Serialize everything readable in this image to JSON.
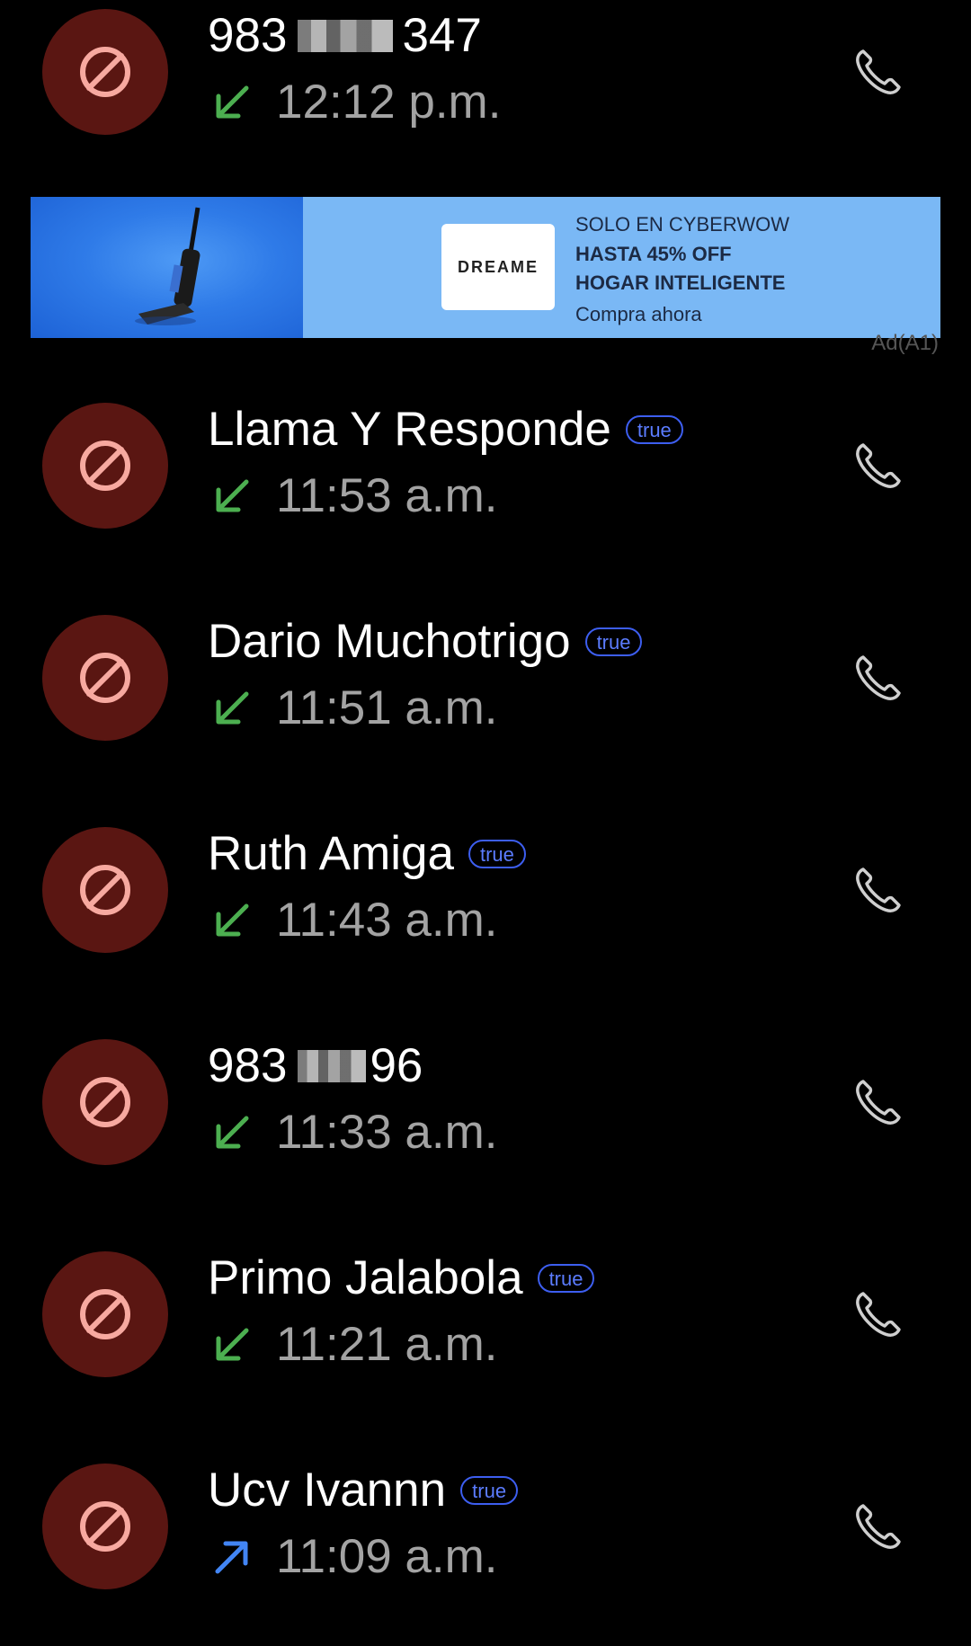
{
  "calls": [
    {
      "name_prefix": "983",
      "name_suffix": "347",
      "redacted": true,
      "time": "12:12 p.m.",
      "direction": "incoming",
      "badge": ""
    },
    {
      "name": "Llama Y Responde",
      "time": "11:53 a.m.",
      "direction": "incoming",
      "badge": "true"
    },
    {
      "name": "Dario Muchotrigo",
      "time": "11:51 a.m.",
      "direction": "incoming",
      "badge": "true"
    },
    {
      "name": "Ruth Amiga",
      "time": "11:43 a.m.",
      "direction": "incoming",
      "badge": "true"
    },
    {
      "name_prefix": "983",
      "name_suffix": "96",
      "redacted": true,
      "time": "11:33 a.m.",
      "direction": "incoming",
      "badge": ""
    },
    {
      "name": "Primo Jalabola",
      "time": "11:21 a.m.",
      "direction": "incoming",
      "badge": "true"
    },
    {
      "name": "Ucv Ivannn",
      "time": "11:09 a.m.",
      "direction": "outgoing",
      "badge": "true"
    }
  ],
  "ad": {
    "brand": "DREAME",
    "line1": "SOLO EN CYBERWOW",
    "line2": "HASTA 45% OFF",
    "line3": "HOGAR INTELIGENTE",
    "cta": "Compra ahora",
    "label": "Ad(A1)"
  },
  "icons": {
    "avatar": "block-icon",
    "incoming": "incoming-call-arrow-icon",
    "outgoing": "outgoing-call-arrow-icon",
    "call": "phone-icon"
  },
  "colors": {
    "background": "#000000",
    "avatar_bg": "#5a1612",
    "block_icon": "#f7a9a0",
    "incoming_arrow": "#4caf50",
    "outgoing_arrow": "#4285f4",
    "badge": "#3d5ef0",
    "time_text": "#a3a3a3",
    "ad_bg": "#7ab8f5"
  }
}
